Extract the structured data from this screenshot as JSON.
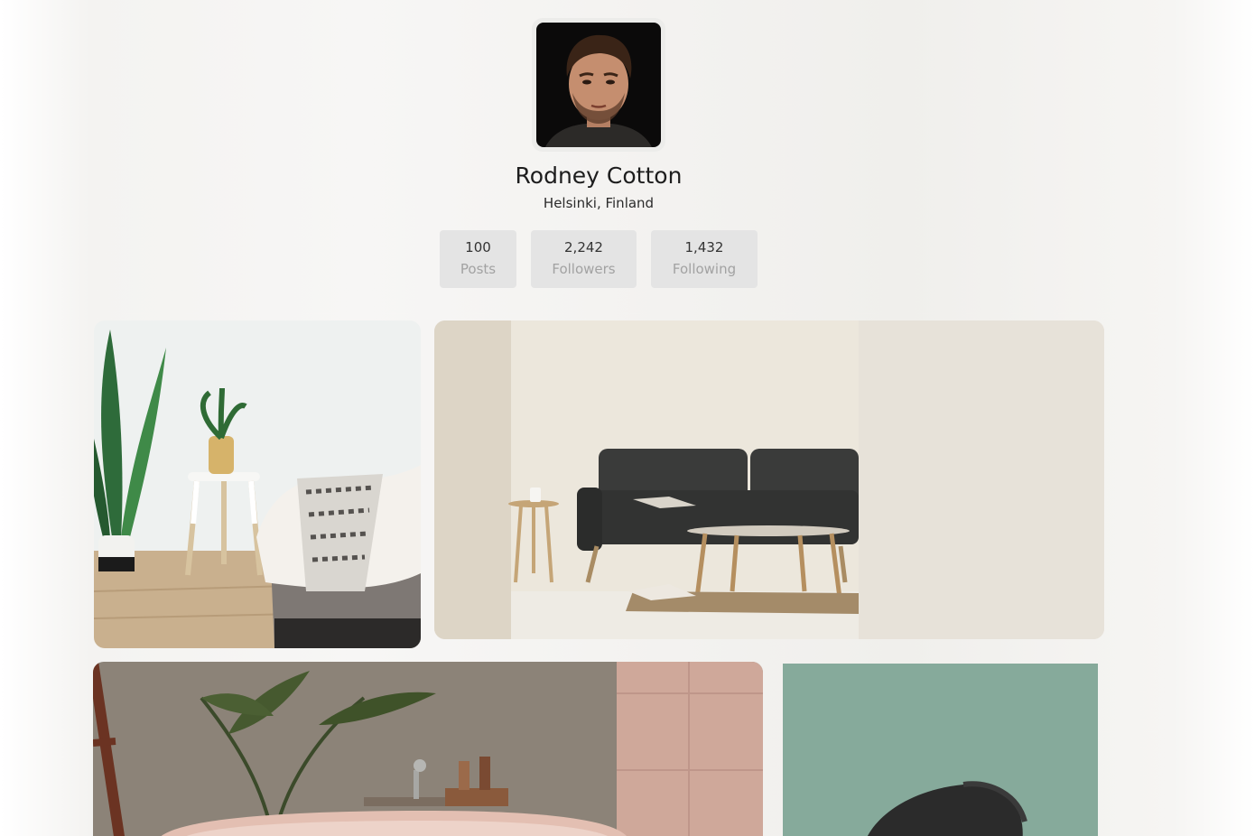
{
  "profile": {
    "name": "Rodney Cotton",
    "location": "Helsinki, Finland",
    "avatar_icon": "user-avatar-photo"
  },
  "stats": [
    {
      "value": "100",
      "label": "Posts"
    },
    {
      "value": "2,242",
      "label": "Followers"
    },
    {
      "value": "1,432",
      "label": "Following"
    }
  ],
  "gallery": [
    {
      "subject": "bedroom-with-plant-and-stool"
    },
    {
      "subject": "living-room-with-gray-sofa"
    },
    {
      "subject": "bathroom-with-pink-tub"
    },
    {
      "subject": "green-wall-with-black-chair"
    }
  ],
  "colors": {
    "background": "#f4f3f1",
    "stat_box": "#e4e4e4",
    "stat_label": "#a2a2a2",
    "text": "#1d1d1d"
  }
}
